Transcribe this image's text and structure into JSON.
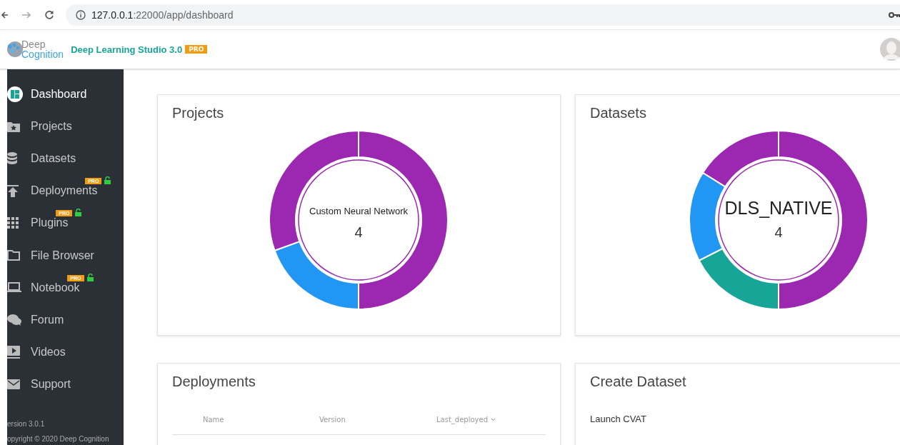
{
  "browser": {
    "url_host": "127.0.0.1",
    "url_path": ":22000/app/dashboard"
  },
  "header": {
    "logo_top": "Deep",
    "logo_bottom": "Cognition",
    "title": "Deep Learning Studio 3.0",
    "badge": "PRO"
  },
  "sidebar": {
    "items": [
      {
        "label": "Dashboard",
        "selected": true
      },
      {
        "label": "Projects",
        "selected": false
      },
      {
        "label": "Datasets",
        "selected": false
      },
      {
        "label": "Deployments",
        "selected": false,
        "badge": "PRO",
        "unlocked": true
      },
      {
        "label": "Plugins",
        "selected": false,
        "badge": "PRO",
        "unlocked": true
      },
      {
        "label": "File Browser",
        "selected": false
      },
      {
        "label": "Notebook",
        "selected": false,
        "badge": "PRO",
        "unlocked": true
      },
      {
        "label": "Forum",
        "selected": false
      },
      {
        "label": "Videos",
        "selected": false
      },
      {
        "label": "Support",
        "selected": false
      }
    ],
    "version": "ersion 3.0.1",
    "copyright": "opyright © 2020 Deep Cognition"
  },
  "projects": {
    "title": "Projects",
    "center_label": "Custom Neural Network",
    "center_count": "4"
  },
  "datasets": {
    "title": "Datasets",
    "center_label": "DLS_NATIVE",
    "center_count": "4"
  },
  "deployments": {
    "title": "Deployments",
    "columns": [
      {
        "label": "Name",
        "sorted": false
      },
      {
        "label": "Version",
        "sorted": false
      },
      {
        "label": "Last_deployed",
        "sorted": true
      }
    ]
  },
  "create_dataset": {
    "title": "Create Dataset",
    "link": "Launch CVAT"
  }
}
